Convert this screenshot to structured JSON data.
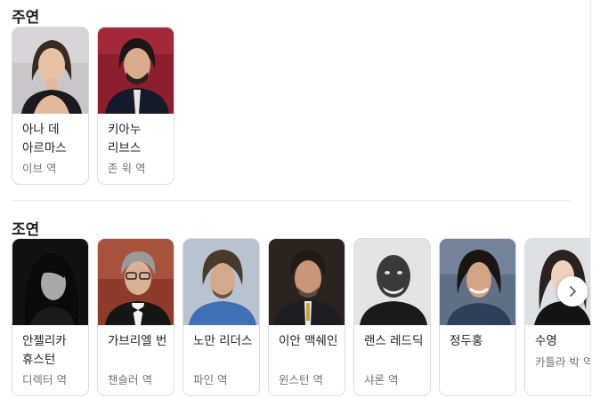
{
  "lead_section": {
    "title": "주연",
    "cast": [
      {
        "name": "아나 데 아르마스",
        "role": "이브 역"
      },
      {
        "name": "키아누 리브스",
        "role": "존 윅 역"
      }
    ]
  },
  "supporting_section": {
    "title": "조연",
    "cast": [
      {
        "name": "안젤리카 휴스턴",
        "role": "디렉터 역"
      },
      {
        "name": "가브리엘 번",
        "role": "챈슬러 역"
      },
      {
        "name": "노만 리더스",
        "role": "파인 역"
      },
      {
        "name": "이안 맥쉐인",
        "role": "윈스턴 역"
      },
      {
        "name": "랜스 레드딕",
        "role": "샤론 역"
      },
      {
        "name": "정두홍",
        "role": ""
      },
      {
        "name": "수영",
        "role": "카틀라 박 역"
      }
    ]
  },
  "carousel": {
    "next_icon": "chevron-right-icon"
  }
}
